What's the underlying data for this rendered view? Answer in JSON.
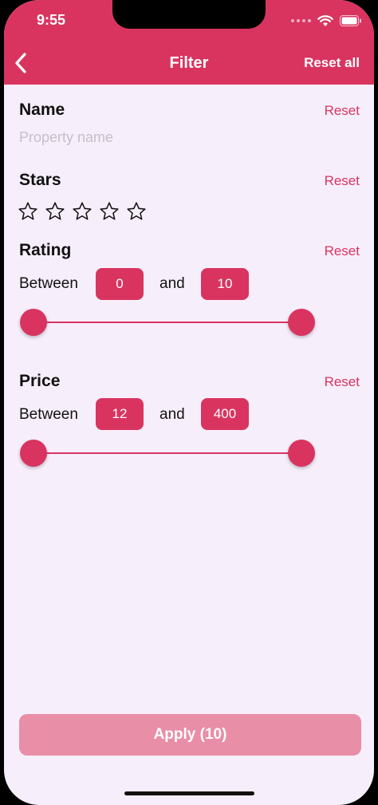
{
  "status_bar": {
    "time": "9:55"
  },
  "nav": {
    "title": "Filter",
    "reset_all_label": "Reset all"
  },
  "sections": {
    "name": {
      "title": "Name",
      "reset_label": "Reset",
      "placeholder": "Property name"
    },
    "stars": {
      "title": "Stars",
      "reset_label": "Reset",
      "selected": 0,
      "max": 5
    },
    "rating": {
      "title": "Rating",
      "reset_label": "Reset",
      "between_label": "Between",
      "and_label": "and",
      "min_value": "0",
      "max_value": "10"
    },
    "price": {
      "title": "Price",
      "reset_label": "Reset",
      "between_label": "Between",
      "and_label": "and",
      "min_value": "12",
      "max_value": "400"
    }
  },
  "apply": {
    "label": "Apply (10)"
  },
  "colors": {
    "accent": "#d93460",
    "background": "#f7eefb",
    "apply_disabled": "#e88ea6"
  }
}
